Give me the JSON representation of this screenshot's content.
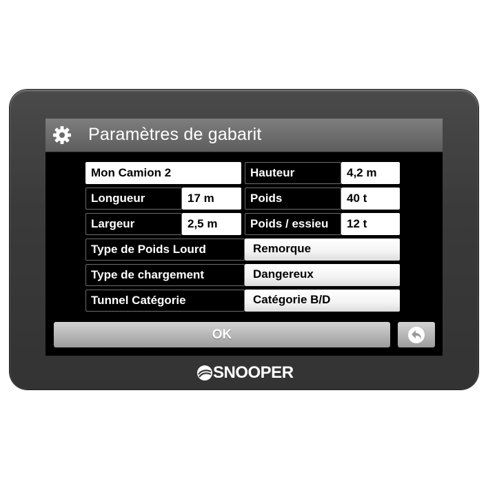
{
  "header": {
    "title": "Paramètres de gabarit",
    "icon": "gear-icon"
  },
  "fields": {
    "name": "Mon Camion 2",
    "hauteur": {
      "label": "Hauteur",
      "value": "4,2 m"
    },
    "longueur": {
      "label": "Longueur",
      "value": "17 m"
    },
    "poids": {
      "label": "Poids",
      "value": "40 t"
    },
    "largeur": {
      "label": "Largeur",
      "value": "2,5 m"
    },
    "poids_essieu": {
      "label": "Poids / essieu",
      "value": "12 t"
    },
    "type_poids_lourd": {
      "label": "Type de Poids Lourd",
      "value": "Remorque"
    },
    "type_chargement": {
      "label": "Type de chargement",
      "value": "Dangereux"
    },
    "tunnel": {
      "label": "Tunnel Catégorie",
      "value": "Catégorie B/D"
    }
  },
  "buttons": {
    "ok_label": "OK",
    "back_icon": "back-arrow-icon"
  },
  "brand": {
    "name": "SNOOPER"
  },
  "colors": {
    "screen_bg": "#000000",
    "titlebar": "#6b6b6b",
    "bezel": "#3a3a3a"
  }
}
